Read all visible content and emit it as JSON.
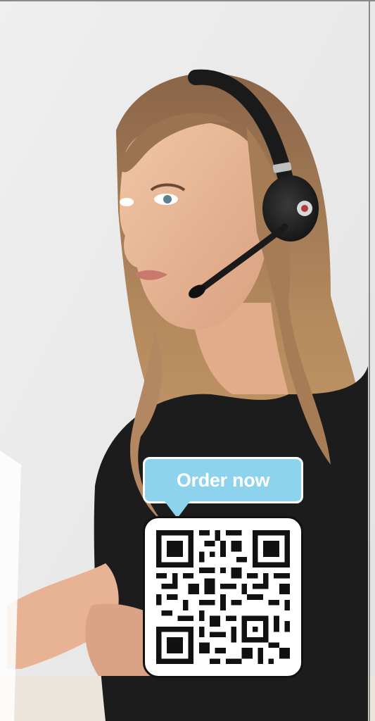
{
  "cta": {
    "label": "Order now",
    "accent_color": "#8dd3ee"
  },
  "qr": {
    "icon": "qr-code-icon"
  },
  "photo": {
    "subject": "person-with-headset"
  }
}
